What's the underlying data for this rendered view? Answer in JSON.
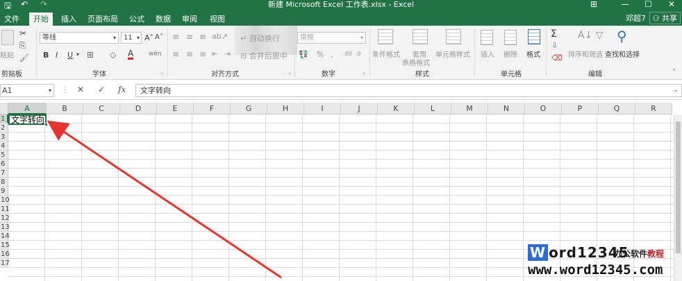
{
  "titlebar": {
    "title": "新建 Microsoft Excel 工作表.xlsx - Excel",
    "save_glyph": "🖫",
    "undo_glyph": "↶",
    "redo_glyph": "↷",
    "ribbon_display_glyph": "⊞",
    "minimize_glyph": "—",
    "maximize_glyph": "☐",
    "close_glyph": "✕"
  },
  "tabs": [
    "文件",
    "开始",
    "插入",
    "页面布局",
    "公式",
    "数据",
    "审阅",
    "视图"
  ],
  "account": {
    "user": "邓超7",
    "share": "共享"
  },
  "ribbon": {
    "clipboard": {
      "paste": "粘贴",
      "label": "剪贴板"
    },
    "font": {
      "name": "等线",
      "size": "11",
      "grow": "A˄",
      "shrink": "A˅",
      "bold": "B",
      "italic": "I",
      "underline": "U",
      "font_color": "A",
      "phonetic": "wén",
      "label": "字体"
    },
    "alignment": {
      "wrap": "自动换行",
      "merge": "合并后居中",
      "label": "对齐方式"
    },
    "number": {
      "format": "常规",
      "percent": "%",
      "comma": ",",
      "inc_dec": ".00",
      "dec_dec": ".0",
      "label": "数字"
    },
    "styles": {
      "conditional": "条件格式",
      "table_a": "套用",
      "table_b": "表格格式",
      "cell_styles": "单元格样式",
      "label": "样式"
    },
    "cells": {
      "insert": "插入",
      "delete": "删除",
      "format": "格式",
      "label": "单元格"
    },
    "editing": {
      "sum": "Σ",
      "sort_filter": "排序和筛选",
      "find_select": "查找和选择",
      "label": "编辑"
    }
  },
  "formula_bar": {
    "name_box": "A1",
    "cancel": "✕",
    "enter": "✓",
    "fx": "fx",
    "content": "文字转向"
  },
  "sheet": {
    "columns": [
      "A",
      "B",
      "C",
      "D",
      "E",
      "F",
      "G",
      "H",
      "I",
      "J",
      "K",
      "L",
      "M",
      "N",
      "O",
      "P",
      "Q",
      "R"
    ],
    "rows": [
      "1",
      "2",
      "3",
      "4",
      "5",
      "6",
      "7",
      "8",
      "9",
      "10",
      "11",
      "12",
      "13",
      "14",
      "15",
      "16",
      "17"
    ],
    "active_cell_value": "文字转向"
  },
  "annotation": {
    "arrow_color": "#e8322e"
  },
  "watermark": {
    "brand_w": "W",
    "brand_rest": "ord12345",
    "tagline_a": "办公软件",
    "tagline_b": "教程",
    "url": "www.word12345.com"
  },
  "colors": {
    "excel_green": "#217346",
    "ribbon_bg": "#f3f3f3",
    "grid_line": "#dadada"
  }
}
